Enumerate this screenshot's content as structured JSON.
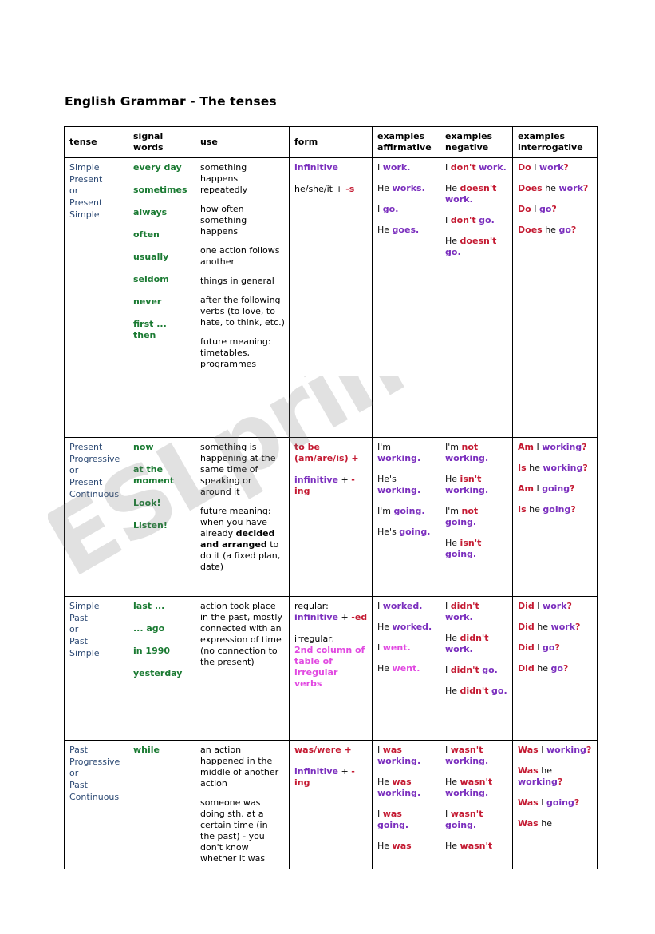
{
  "document": {
    "title": "English Grammar - The tenses",
    "watermark": "ESLprintables.com"
  },
  "colors": {
    "tense_name": "#2d4a74",
    "signal_word": "#1a7a32",
    "verb_purple": "#7b2fbe",
    "auxiliary_red": "#c41a32",
    "irregular_magenta": "#e149e1",
    "plain_text": "#000000",
    "border": "#000000",
    "watermark": "#787878"
  },
  "table": {
    "headers": [
      "tense",
      "signal words",
      "use",
      "form",
      "examples affirmative",
      "examples negative",
      "examples interrogative"
    ],
    "rows": [
      {
        "tense_lines": [
          "Simple",
          "Present",
          "or",
          "Present",
          "Simple"
        ],
        "signal_words": [
          "every day",
          "sometimes",
          "always",
          "often",
          "usually",
          "seldom",
          "never",
          "first ... then"
        ],
        "use": [
          "something happens repeatedly",
          "how often something happens",
          "one action follows another",
          "things in general",
          "after the following verbs (to love, to hate, to think, etc.)",
          "future meaning: timetables, programmes"
        ],
        "form": {
          "line1_purple": "infinitive",
          "line2_plain": "he/she/it + ",
          "line2_red": "-s"
        },
        "affirmative": [
          {
            "subject": "I",
            "verb": "work",
            "punct": "."
          },
          {
            "subject": "He",
            "verb": "works",
            "punct": "."
          },
          {
            "subject": "I",
            "verb": "go",
            "punct": "."
          },
          {
            "subject": "He",
            "verb": "goes",
            "punct": "."
          }
        ],
        "negative": [
          {
            "subject": "I",
            "aux": "don't",
            "verb": "work",
            "punct": "."
          },
          {
            "subject": "He",
            "aux": "doesn't",
            "verb": "work",
            "punct": "."
          },
          {
            "subject": "I",
            "aux": "don't",
            "verb": "go",
            "punct": "."
          },
          {
            "subject": "He",
            "aux": "doesn't",
            "verb": "go",
            "punct": "."
          }
        ],
        "interrogative": [
          {
            "aux": "Do",
            "subject": "I",
            "verb": "work",
            "punct": "?"
          },
          {
            "aux": "Does",
            "subject": "he",
            "verb": "work",
            "punct": "?"
          },
          {
            "aux": "Do",
            "subject": "I",
            "verb": "go",
            "punct": "?"
          },
          {
            "aux": "Does",
            "subject": "he",
            "verb": "go",
            "punct": "?"
          }
        ]
      },
      {
        "tense_lines": [
          "Present",
          "Progressive",
          "or",
          "Present",
          "Continuous"
        ],
        "signal_words": [
          "now",
          "at the moment",
          "Look!",
          "Listen!"
        ],
        "use_rich": {
          "part1": "something is happening at the same time of speaking or around it",
          "part2_a": "future meaning: when you have already ",
          "part2_bold": "decided and arranged",
          "part2_b": " to do it (a fixed plan, date)"
        },
        "form": {
          "line1_red": "to be (am/are/is) +",
          "line2_purple": "infinitive",
          "line2_plain": " + ",
          "line2_red": "-ing"
        },
        "affirmative": [
          {
            "subject": "I'm",
            "verb": "working",
            "punct": "."
          },
          {
            "subject": "He's",
            "verb": "working",
            "punct": "."
          },
          {
            "subject": "I'm",
            "verb": "going",
            "punct": "."
          },
          {
            "subject": "He's",
            "verb": "going",
            "punct": "."
          }
        ],
        "negative": [
          {
            "subject": "I'm",
            "aux": "not",
            "verb": "working",
            "punct": "."
          },
          {
            "subject": "He",
            "aux": "isn't",
            "verb": "working",
            "punct": "."
          },
          {
            "subject": "I'm",
            "aux": "not",
            "verb": "going",
            "punct": "."
          },
          {
            "subject": "He",
            "aux": "isn't",
            "verb": "going",
            "punct": "."
          }
        ],
        "interrogative": [
          {
            "aux": "Am",
            "subject": "I",
            "verb": "working",
            "punct": "?"
          },
          {
            "aux": "Is",
            "subject": "he",
            "verb": "working",
            "punct": "?"
          },
          {
            "aux": "Am",
            "subject": "I",
            "verb": "going",
            "punct": "?"
          },
          {
            "aux": "Is",
            "subject": "he",
            "verb": "going",
            "punct": "?"
          }
        ]
      },
      {
        "tense_lines": [
          "Simple",
          "Past",
          "or",
          "Past",
          "Simple"
        ],
        "signal_words": [
          "last ...",
          "... ago",
          "in 1990",
          "yesterday"
        ],
        "use": [
          "action took place in the past, mostly connected with an expression of time (no connection to the present)"
        ],
        "form": {
          "regular_label": "regular:",
          "regular_purple": "infinitive",
          "regular_plain": " + ",
          "regular_red": "-ed",
          "irregular_label": "irregular:",
          "irregular_magenta": "2nd column of table of irregular verbs"
        },
        "affirmative": [
          {
            "subject": "I",
            "verb": "worked",
            "punct": ".",
            "color": "purple"
          },
          {
            "subject": "He",
            "verb": "worked",
            "punct": ".",
            "color": "purple"
          },
          {
            "subject": "I",
            "verb": "went",
            "punct": ".",
            "color": "magenta"
          },
          {
            "subject": "He",
            "verb": "went",
            "punct": ".",
            "color": "magenta"
          }
        ],
        "negative": [
          {
            "subject": "I",
            "aux": "didn't",
            "verb": "work",
            "punct": "."
          },
          {
            "subject": "He",
            "aux": "didn't",
            "verb": "work",
            "punct": "."
          },
          {
            "subject": "I",
            "aux": "didn't",
            "verb": "go",
            "punct": "."
          },
          {
            "subject": "He",
            "aux": "didn't",
            "verb": "go",
            "punct": "."
          }
        ],
        "interrogative": [
          {
            "aux": "Did",
            "subject": "I",
            "verb": "work",
            "punct": "?"
          },
          {
            "aux": "Did",
            "subject": "he",
            "verb": "work",
            "punct": "?"
          },
          {
            "aux": "Did",
            "subject": "I",
            "verb": "go",
            "punct": "?"
          },
          {
            "aux": "Did",
            "subject": "he",
            "verb": "go",
            "punct": "?"
          }
        ]
      },
      {
        "tense_lines": [
          "Past",
          "Progressive",
          "or",
          "Past",
          "Continuous"
        ],
        "signal_words": [
          "while"
        ],
        "use": [
          "an action happened in the middle of another action",
          "someone was doing sth. at a certain time (in the past) - you don't know whether it was"
        ],
        "form": {
          "line1_red": "was/were +",
          "line2_purple": "infinitive",
          "line2_plain": " + ",
          "line2_red": "-ing"
        },
        "affirmative": [
          {
            "subject": "I",
            "aux": "was",
            "verb": "working",
            "punct": "."
          },
          {
            "subject": "He",
            "aux": "was",
            "verb": "working",
            "punct": "."
          },
          {
            "subject": "I",
            "aux": "was",
            "verb": "going",
            "punct": "."
          },
          {
            "subject": "He",
            "aux": "was",
            "verb": "",
            "punct": ""
          }
        ],
        "negative": [
          {
            "subject": "I",
            "aux": "wasn't",
            "verb": "working",
            "punct": "."
          },
          {
            "subject": "He",
            "aux": "wasn't",
            "verb": "working",
            "punct": "."
          },
          {
            "subject": "I",
            "aux": "wasn't",
            "verb": "going",
            "punct": "."
          },
          {
            "subject": "He",
            "aux": "wasn't",
            "verb": "",
            "punct": ""
          }
        ],
        "interrogative": [
          {
            "aux": "Was",
            "subject": "I",
            "verb": "working",
            "punct": "?"
          },
          {
            "aux": "Was",
            "subject": "he",
            "verb": "working",
            "punct": "?"
          },
          {
            "aux": "Was",
            "subject": "I",
            "verb": "going",
            "punct": "?"
          },
          {
            "aux": "Was",
            "subject": "he",
            "verb": "",
            "punct": ""
          }
        ]
      }
    ]
  }
}
